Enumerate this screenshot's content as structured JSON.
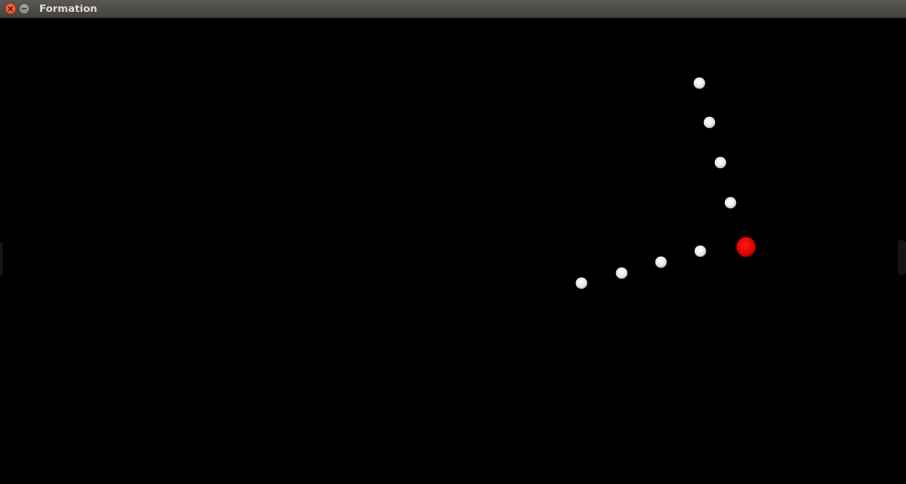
{
  "window": {
    "title": "Formation"
  },
  "agents": {
    "follower_color": "#ececec",
    "leader_color": "#dd0000",
    "follower_count": 8,
    "leader_count": 1
  },
  "icons": {
    "close": "close-icon",
    "minimize": "minimize-icon"
  }
}
